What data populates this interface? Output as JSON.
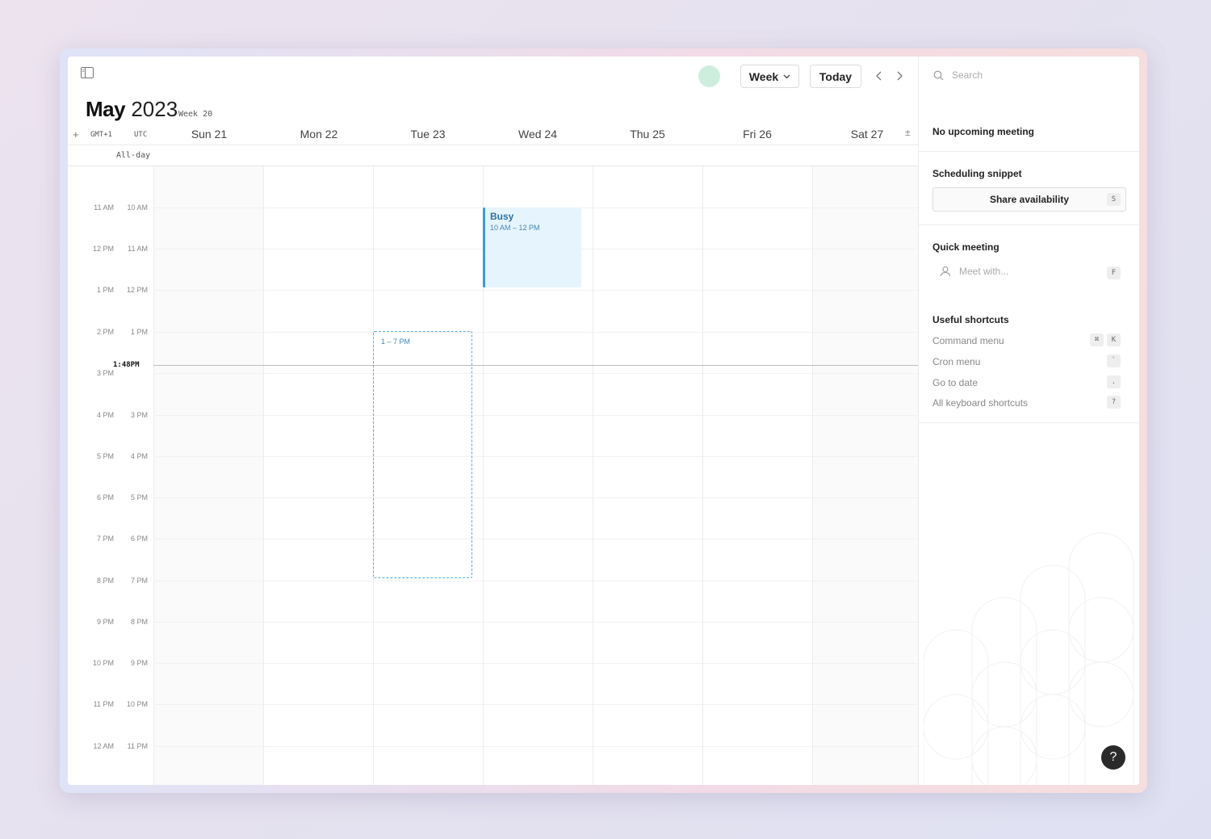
{
  "header": {
    "month": "May",
    "year": "2023",
    "week_label": "Week 20",
    "view_label": "Week",
    "today_label": "Today"
  },
  "timezones": {
    "primary": "GMT+1",
    "secondary": "UTC"
  },
  "allday_label": "All-day",
  "days": [
    "Sun 21",
    "Mon 22",
    "Tue 23",
    "Wed 24",
    "Thu 25",
    "Fri 26",
    "Sat 27"
  ],
  "hours": [
    {
      "gmt": "11 AM",
      "utc": "10 AM"
    },
    {
      "gmt": "12 PM",
      "utc": "11 AM"
    },
    {
      "gmt": "1 PM",
      "utc": "12 PM"
    },
    {
      "gmt": "2 PM",
      "utc": "1 PM"
    },
    {
      "gmt": "3 PM",
      "utc": ""
    },
    {
      "gmt": "4 PM",
      "utc": "3 PM"
    },
    {
      "gmt": "5 PM",
      "utc": "4 PM"
    },
    {
      "gmt": "6 PM",
      "utc": "5 PM"
    },
    {
      "gmt": "7 PM",
      "utc": "6 PM"
    },
    {
      "gmt": "8 PM",
      "utc": "7 PM"
    },
    {
      "gmt": "9 PM",
      "utc": "8 PM"
    },
    {
      "gmt": "10 PM",
      "utc": "9 PM"
    },
    {
      "gmt": "11 PM",
      "utc": "10 PM"
    },
    {
      "gmt": "12 AM",
      "utc": "11 PM"
    }
  ],
  "now_label": "1:48PM",
  "events": {
    "busy": {
      "title": "Busy",
      "time": "10 AM – 12 PM"
    },
    "selection": {
      "time": "1 – 7 PM"
    }
  },
  "panel": {
    "search_placeholder": "Search",
    "upcoming": "No upcoming meeting",
    "scheduling_title": "Scheduling snippet",
    "share_label": "Share availability",
    "share_key": "S",
    "quick_title": "Quick meeting",
    "meet_placeholder": "Meet with...",
    "meet_key": "F",
    "shortcuts_title": "Useful shortcuts",
    "shortcuts": [
      {
        "label": "Command menu",
        "keys": [
          "⌘",
          "K"
        ]
      },
      {
        "label": "Cron menu",
        "keys": [
          "`"
        ]
      },
      {
        "label": "Go to date",
        "keys": [
          "."
        ]
      },
      {
        "label": "All keyboard shortcuts",
        "keys": [
          "?"
        ]
      }
    ],
    "help_label": "?"
  },
  "colors": {
    "event_accent": "#3b9be0",
    "event_fill": "#e6f5fd",
    "avatar": "#cdeedd"
  }
}
